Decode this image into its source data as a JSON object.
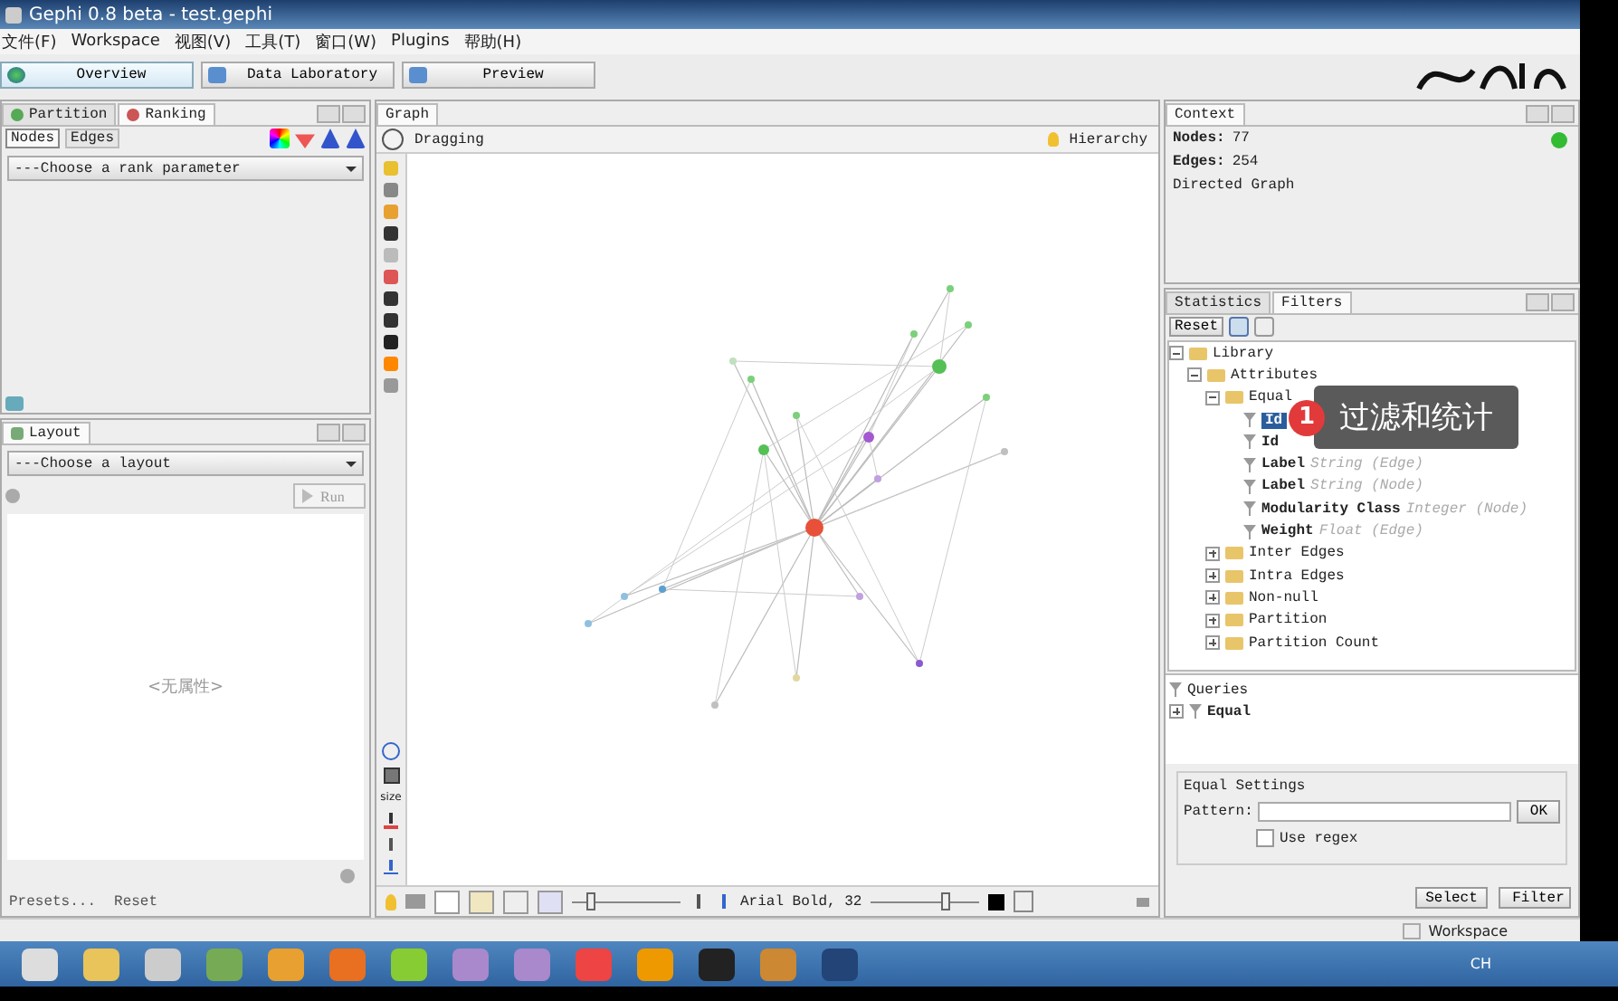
{
  "window": {
    "title": "Gephi 0.8 beta - test.gephi"
  },
  "menu": [
    "文件(F)",
    "Workspace",
    "视图(V)",
    "工具(T)",
    "窗口(W)",
    "Plugins",
    "帮助(H)"
  ],
  "workspace_tabs": [
    {
      "label": "Overview",
      "selected": true
    },
    {
      "label": "Data Laboratory",
      "selected": false
    },
    {
      "label": "Preview",
      "selected": false
    }
  ],
  "ranking_panel": {
    "tabs": [
      {
        "label": "Partition",
        "selected": false
      },
      {
        "label": "Ranking",
        "selected": true
      }
    ],
    "subtabs": [
      {
        "label": "Nodes",
        "selected": true
      },
      {
        "label": "Edges",
        "selected": false
      }
    ],
    "dropdown": "---Choose a rank parameter"
  },
  "layout_panel": {
    "title": "Layout",
    "dropdown": "---Choose a layout",
    "run_button": "Run",
    "properties_placeholder": "<无属性>",
    "footer": [
      "Presets...",
      "Reset"
    ]
  },
  "graph_panel": {
    "tab": "Graph",
    "mode": "Dragging",
    "hierarchy": "Hierarchy",
    "tools_size_label": "size",
    "font_label": "Arial Bold, 32",
    "edge_scale": {
      "level": 0.15
    },
    "label_size": {
      "level": 0.7
    }
  },
  "context_panel": {
    "tab": "Context",
    "stats": [
      {
        "label": "Nodes:",
        "value": "77"
      },
      {
        "label": "Edges:",
        "value": "254"
      }
    ],
    "graph_type": "Directed Graph"
  },
  "filters_panel": {
    "tabs": [
      {
        "label": "Statistics",
        "selected": false
      },
      {
        "label": "Filters",
        "selected": true
      }
    ],
    "reset": "Reset",
    "tree": [
      {
        "kind": "folder",
        "label": "Library",
        "expanded": true,
        "children": [
          {
            "kind": "folder",
            "label": "Attributes",
            "expanded": true,
            "children": [
              {
                "kind": "folder",
                "label": "Equal",
                "expanded": true,
                "children": [
                  {
                    "kind": "filter",
                    "label": "Id",
                    "selected": true
                  },
                  {
                    "kind": "filter",
                    "label": "Id",
                    "selected": false
                  },
                  {
                    "kind": "filter",
                    "label": "Label",
                    "type": "String (Edge)",
                    "selected": false
                  },
                  {
                    "kind": "filter",
                    "label": "Label",
                    "type": "String (Node)",
                    "selected": false
                  },
                  {
                    "kind": "filter",
                    "label": "Modularity Class",
                    "type": "Integer (Node)",
                    "selected": false
                  },
                  {
                    "kind": "filter",
                    "label": "Weight",
                    "type": "Float (Edge)",
                    "selected": false
                  }
                ]
              },
              {
                "kind": "folder",
                "label": "Inter Edges",
                "expanded": false
              },
              {
                "kind": "folder",
                "label": "Intra Edges",
                "expanded": false
              },
              {
                "kind": "folder",
                "label": "Non-null",
                "expanded": false
              },
              {
                "kind": "folder",
                "label": "Partition",
                "expanded": false
              },
              {
                "kind": "folder",
                "label": "Partition Count",
                "expanded": false
              }
            ]
          }
        ]
      }
    ],
    "queries_title": "Queries",
    "queries": [
      {
        "label": "Equal",
        "expanded": false
      }
    ],
    "settings": {
      "title": "Equal Settings",
      "pattern_label": "Pattern:",
      "ok_button": "OK",
      "use_regex": {
        "label": "Use regex",
        "checked": false
      }
    },
    "buttons": [
      "Select",
      "Filter"
    ]
  },
  "callout": {
    "number": "1",
    "text": "过滤和统计"
  },
  "status_bar": {
    "workspace": "Workspace"
  },
  "taskbar": {
    "language": "CH"
  }
}
